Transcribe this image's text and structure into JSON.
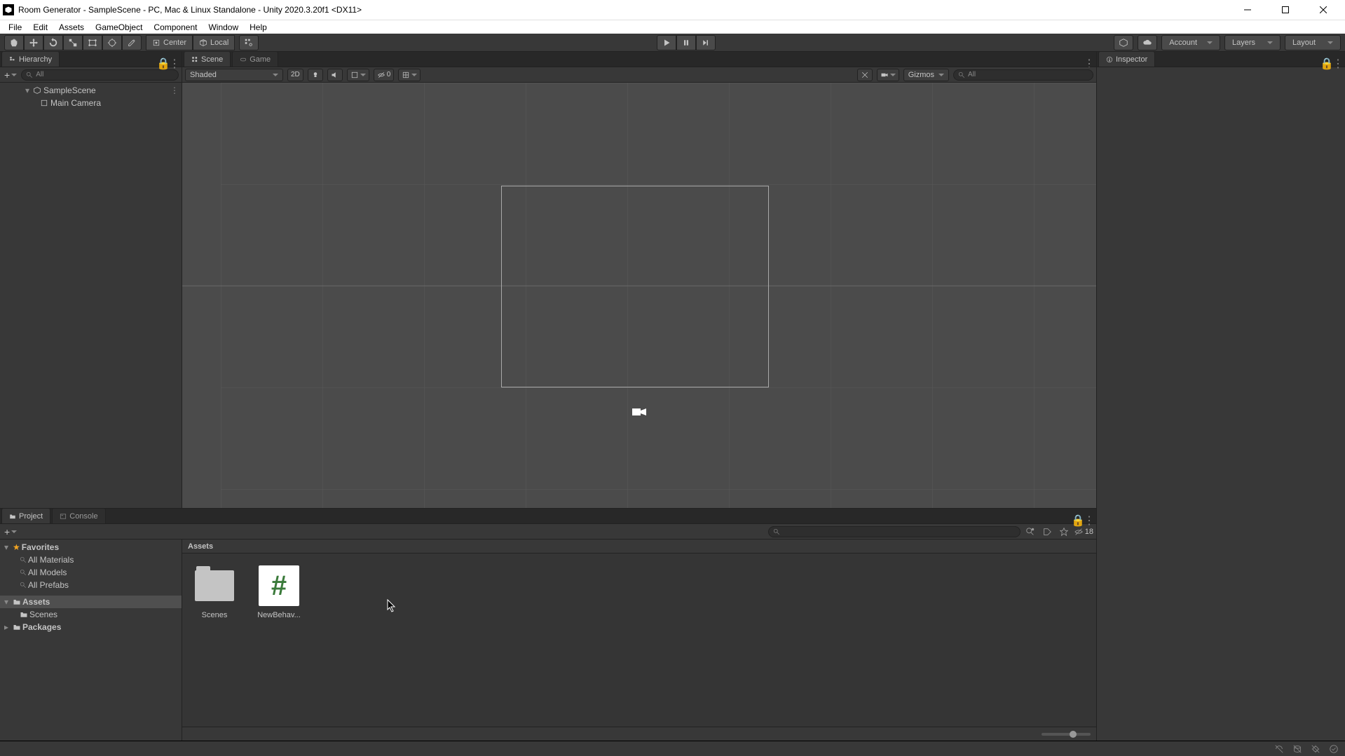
{
  "titlebar": {
    "title": "Room Generator - SampleScene - PC, Mac & Linux Standalone - Unity 2020.3.20f1 <DX11>"
  },
  "menu": {
    "items": [
      "File",
      "Edit",
      "Assets",
      "GameObject",
      "Component",
      "Window",
      "Help"
    ]
  },
  "toolbar": {
    "center_label": "Center",
    "local_label": "Local",
    "account": "Account",
    "layers": "Layers",
    "layout": "Layout"
  },
  "hierarchy": {
    "tab": "Hierarchy",
    "search_placeholder": "All",
    "scene": "SampleScene",
    "items": [
      "Main Camera"
    ]
  },
  "scene": {
    "tab_scene": "Scene",
    "tab_game": "Game",
    "shading_mode": "Shaded",
    "mode_2d": "2D",
    "gizmo_count": "0",
    "gizmos_label": "Gizmos",
    "search_placeholder": "All"
  },
  "inspector": {
    "tab": "Inspector"
  },
  "project": {
    "tab_project": "Project",
    "tab_console": "Console",
    "hidden_count": "18",
    "favorites_label": "Favorites",
    "fav_items": [
      "All Materials",
      "All Models",
      "All Prefabs"
    ],
    "assets_label": "Assets",
    "assets_children": [
      "Scenes"
    ],
    "packages_label": "Packages",
    "breadcrumb": "Assets",
    "grid_items": [
      {
        "name": "Scenes",
        "type": "folder"
      },
      {
        "name": "NewBehav...",
        "type": "script"
      }
    ]
  }
}
